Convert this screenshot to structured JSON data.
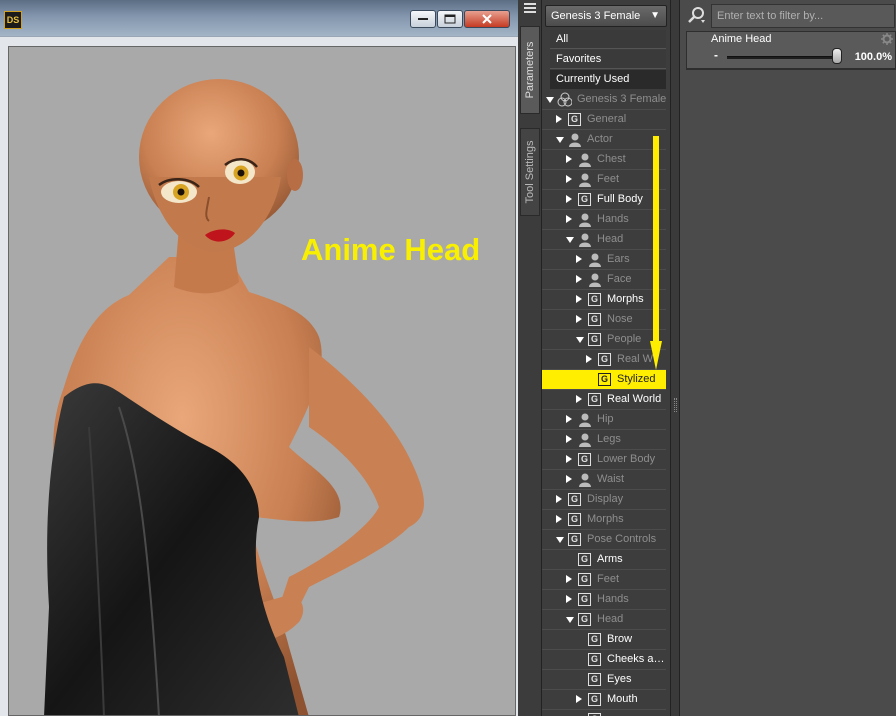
{
  "viewport": {
    "app_logo": "DS",
    "overlay_label": "Anime Head"
  },
  "side_tabs": [
    {
      "label": "Parameters"
    },
    {
      "label": "Tool Settings"
    }
  ],
  "tree_panel": {
    "figure_select": "Genesis 3 Female",
    "filters": [
      "All",
      "Favorites",
      "Currently Used"
    ],
    "rows": [
      {
        "label": "Genesis 3 Female",
        "icon": "figure-icon",
        "expander": "down",
        "indent": 0,
        "style": "dim"
      },
      {
        "label": "General",
        "icon": "group-icon",
        "expander": "right",
        "indent": 1,
        "style": "dim"
      },
      {
        "label": "Actor",
        "icon": "person-icon",
        "expander": "down",
        "indent": 1,
        "style": "dim"
      },
      {
        "label": "Chest",
        "icon": "person-icon",
        "expander": "right",
        "indent": 2,
        "style": "dim"
      },
      {
        "label": "Feet",
        "icon": "person-icon",
        "expander": "right",
        "indent": 2,
        "style": "dim"
      },
      {
        "label": "Full Body",
        "icon": "group-icon",
        "expander": "right",
        "indent": 2,
        "style": "bright"
      },
      {
        "label": "Hands",
        "icon": "person-icon",
        "expander": "right",
        "indent": 2,
        "style": "dim"
      },
      {
        "label": "Head",
        "icon": "person-icon",
        "expander": "down",
        "indent": 2,
        "style": "dim"
      },
      {
        "label": "Ears",
        "icon": "person-icon",
        "expander": "right",
        "indent": 3,
        "style": "dim"
      },
      {
        "label": "Face",
        "icon": "person-icon",
        "expander": "right",
        "indent": 3,
        "style": "dim"
      },
      {
        "label": "Morphs",
        "icon": "group-icon",
        "expander": "right",
        "indent": 3,
        "style": "bright"
      },
      {
        "label": "Nose",
        "icon": "group-icon",
        "expander": "right",
        "indent": 3,
        "style": "dim"
      },
      {
        "label": "People",
        "icon": "group-icon",
        "expander": "down",
        "indent": 3,
        "style": "dim"
      },
      {
        "label": "Real W",
        "icon": "group-icon",
        "expander": "right",
        "indent": 4,
        "style": "dim"
      },
      {
        "label": "Stylized",
        "icon": "group-icon",
        "expander": "none",
        "indent": 4,
        "style": "selected"
      },
      {
        "label": "Real World",
        "icon": "group-icon",
        "expander": "right",
        "indent": 3,
        "style": "bright"
      },
      {
        "label": "Hip",
        "icon": "person-icon",
        "expander": "right",
        "indent": 2,
        "style": "dim"
      },
      {
        "label": "Legs",
        "icon": "person-icon",
        "expander": "right",
        "indent": 2,
        "style": "dim"
      },
      {
        "label": "Lower Body",
        "icon": "group-icon",
        "expander": "right",
        "indent": 2,
        "style": "dim"
      },
      {
        "label": "Waist",
        "icon": "person-icon",
        "expander": "right",
        "indent": 2,
        "style": "dim"
      },
      {
        "label": "Display",
        "icon": "group-icon",
        "expander": "right",
        "indent": 1,
        "style": "dim"
      },
      {
        "label": "Morphs",
        "icon": "group-icon",
        "expander": "right",
        "indent": 1,
        "style": "dim"
      },
      {
        "label": "Pose Controls",
        "icon": "group-icon",
        "expander": "down",
        "indent": 1,
        "style": "dim"
      },
      {
        "label": "Arms",
        "icon": "group-icon",
        "expander": "none",
        "indent": 2,
        "style": "bright"
      },
      {
        "label": "Feet",
        "icon": "group-icon",
        "expander": "right",
        "indent": 2,
        "style": "dim"
      },
      {
        "label": "Hands",
        "icon": "group-icon",
        "expander": "right",
        "indent": 2,
        "style": "dim"
      },
      {
        "label": "Head",
        "icon": "group-icon",
        "expander": "down",
        "indent": 2,
        "style": "dim"
      },
      {
        "label": "Brow",
        "icon": "group-icon",
        "expander": "none",
        "indent": 3,
        "style": "bright"
      },
      {
        "label": "Cheeks a…",
        "icon": "group-icon",
        "expander": "none",
        "indent": 3,
        "style": "bright"
      },
      {
        "label": "Eyes",
        "icon": "group-icon",
        "expander": "none",
        "indent": 3,
        "style": "bright"
      },
      {
        "label": "Mouth",
        "icon": "group-icon",
        "expander": "right",
        "indent": 3,
        "style": "bright"
      },
      {
        "label": "",
        "icon": "group-icon",
        "expander": "none",
        "indent": 3,
        "style": "bright"
      }
    ]
  },
  "param_panel": {
    "filter_placeholder": "Enter text to filter by...",
    "param_name": "Anime Head",
    "param_minus": "-",
    "param_value": "100.0%",
    "param_fraction": 1.0
  },
  "colors": {
    "highlight": "#ffee00",
    "overlay_text": "#f8f000",
    "panel_bg": "#3d3d3d"
  }
}
